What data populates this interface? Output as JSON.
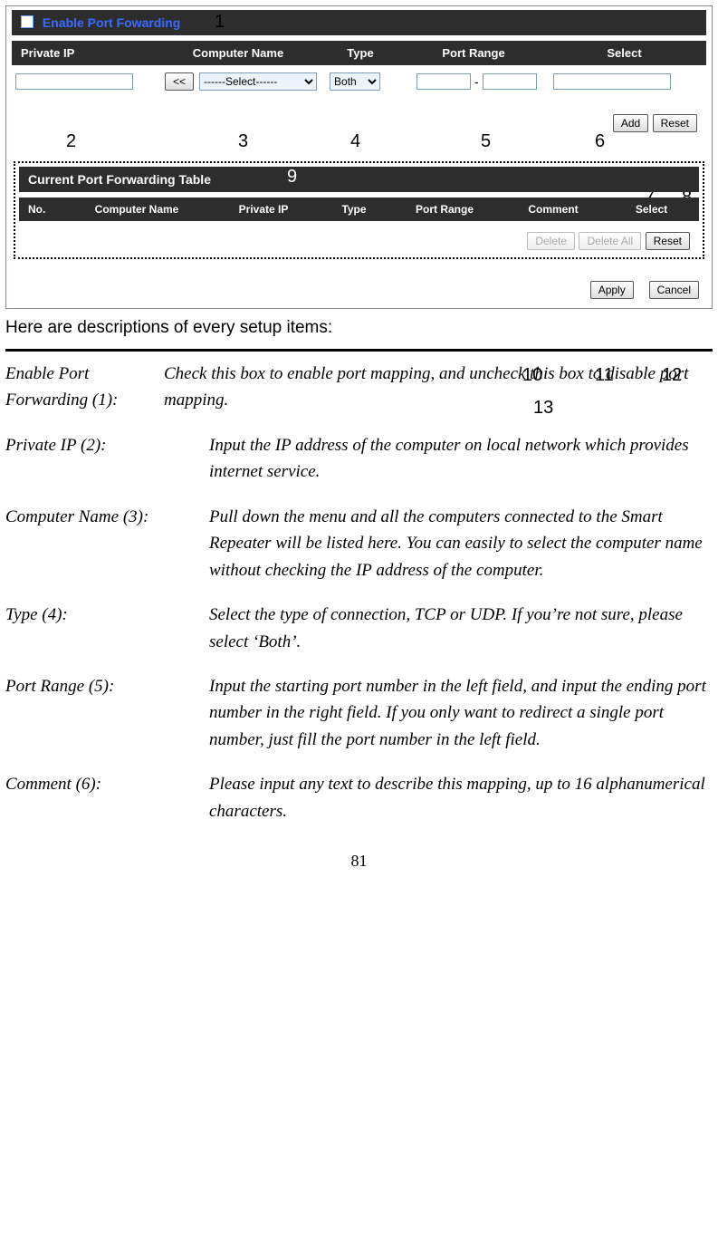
{
  "panel": {
    "enable_label": "Enable Port Fowarding",
    "columns": {
      "private_ip": "Private IP",
      "computer_name": "Computer Name",
      "type": "Type",
      "port_range": "Port Range",
      "select": "Select"
    },
    "copy_btn": "<<",
    "select_placeholder": "------Select------",
    "type_value": "Both",
    "dash": "-",
    "add_btn": "Add",
    "reset_btn": "Reset",
    "table_title": "Current Port Forwarding Table",
    "table_cols": {
      "no": "No.",
      "computer_name": "Computer Name",
      "private_ip": "Private IP",
      "type": "Type",
      "port_range": "Port Range",
      "comment": "Comment",
      "select": "Select"
    },
    "delete_btn": "Delete",
    "delete_all_btn": "Delete All",
    "reset2_btn": "Reset",
    "apply_btn": "Apply",
    "cancel_btn": "Cancel"
  },
  "callouts": {
    "n1": "1",
    "n2": "2",
    "n3": "3",
    "n4": "4",
    "n5": "5",
    "n6": "6",
    "n7": "7",
    "n8": "8",
    "n9": "9",
    "n10": "10",
    "n11": "11",
    "n12": "12",
    "n13": "13"
  },
  "intro": "Here are descriptions of every setup items:",
  "definitions": [
    {
      "term": "Enable Port Forwarding (1):",
      "desc": "Check this box to enable port mapping, and uncheck this box to disable port mapping.",
      "dtw": 175,
      "ddpad": 0
    },
    {
      "term": "Private IP (2):",
      "desc": "Input the IP address of the computer on local network which provides internet service."
    },
    {
      "term": "Computer Name (3):",
      "desc": "Pull down the menu and all the computers connected to the Smart Repeater will be listed here. You can easily to select the computer name without checking the IP address of the computer."
    },
    {
      "term": "Type (4):",
      "desc": "Select the type of connection, TCP or UDP. If you’re not sure, please select ‘Both’."
    },
    {
      "term": "Port Range (5):",
      "desc": "Input the starting port number in the left field, and input the ending port number in the right field. If you only want to redirect a single port number, just fill the port number in the left field."
    },
    {
      "term": "Comment (6):",
      "desc": "Please input any text to describe this mapping, up to 16 alphanumerical characters."
    }
  ],
  "page_number": "81"
}
